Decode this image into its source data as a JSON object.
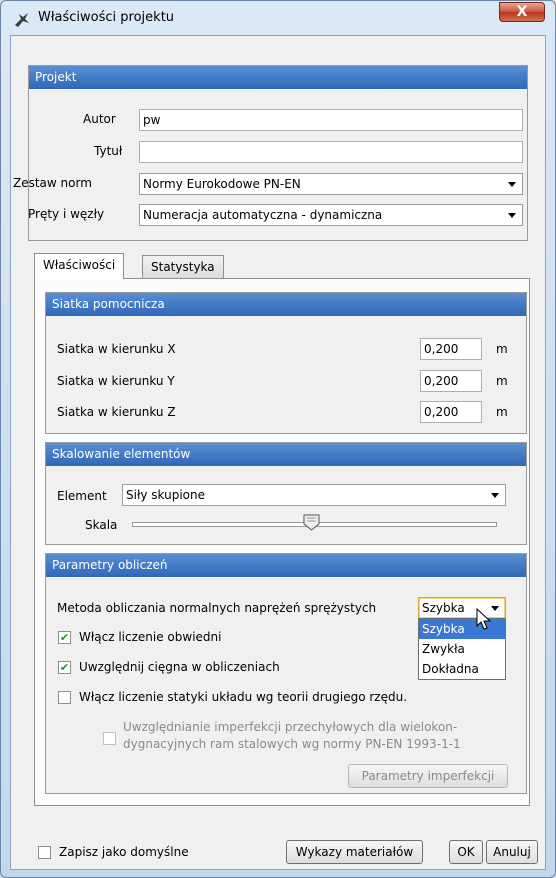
{
  "window": {
    "title": "Właściwości projektu",
    "close_label": "X"
  },
  "projekt": {
    "header": "Projekt",
    "autor_label": "Autor",
    "autor_value": "pw",
    "tytul_label": "Tytuł",
    "tytul_value": "",
    "zestaw_label": "Zestaw norm",
    "zestaw_value": "Normy Eurokodowe PN-EN",
    "prety_label": "Pręty i węzły",
    "prety_value": "Numeracja automatyczna - dynamiczna"
  },
  "tabs": [
    {
      "label": "Właściwości"
    },
    {
      "label": "Statystyka"
    }
  ],
  "siatka": {
    "header": "Siatka pomocnicza",
    "rows": [
      {
        "label": "Siatka w kierunku X",
        "value": "0,200",
        "unit": "m"
      },
      {
        "label": "Siatka w kierunku Y",
        "value": "0,200",
        "unit": "m"
      },
      {
        "label": "Siatka w kierunku Z",
        "value": "0,200",
        "unit": "m"
      }
    ]
  },
  "skalowanie": {
    "header": "Skalowanie elementów",
    "element_label": "Element",
    "element_value": "Siły skupione",
    "skala_label": "Skala",
    "skala_level": 0.49
  },
  "parametry": {
    "header": "Parametry obliczeń",
    "metoda_label": "Metoda obliczania normalnych naprężeń sprężystych",
    "metoda_value": "Szybka",
    "metoda_options": [
      "Szybka",
      "Zwykła",
      "Dokładna"
    ],
    "check1": {
      "label": "Włącz liczenie obwiedni",
      "checked": true
    },
    "check2": {
      "label": "Uwzględnij cięgna w obliczeniach",
      "checked": true
    },
    "check3": {
      "label": "Włącz liczenie statyki układu wg teorii drugiego rzędu.",
      "checked": false
    },
    "imperf_line1": "Uwzględnianie imperfekcji przechyłowych dla wielokon-",
    "imperf_line2": "dygnacyjnych ram stalowych wg normy PN-EN 1993-1-1",
    "imperf_button": "Parametry imperfekcji"
  },
  "footer": {
    "zapisz_label": "Zapisz jako domyślne",
    "wykazy_button": "Wykazy materiałów",
    "ok_button": "OK",
    "anuluj_button": "Anuluj"
  }
}
